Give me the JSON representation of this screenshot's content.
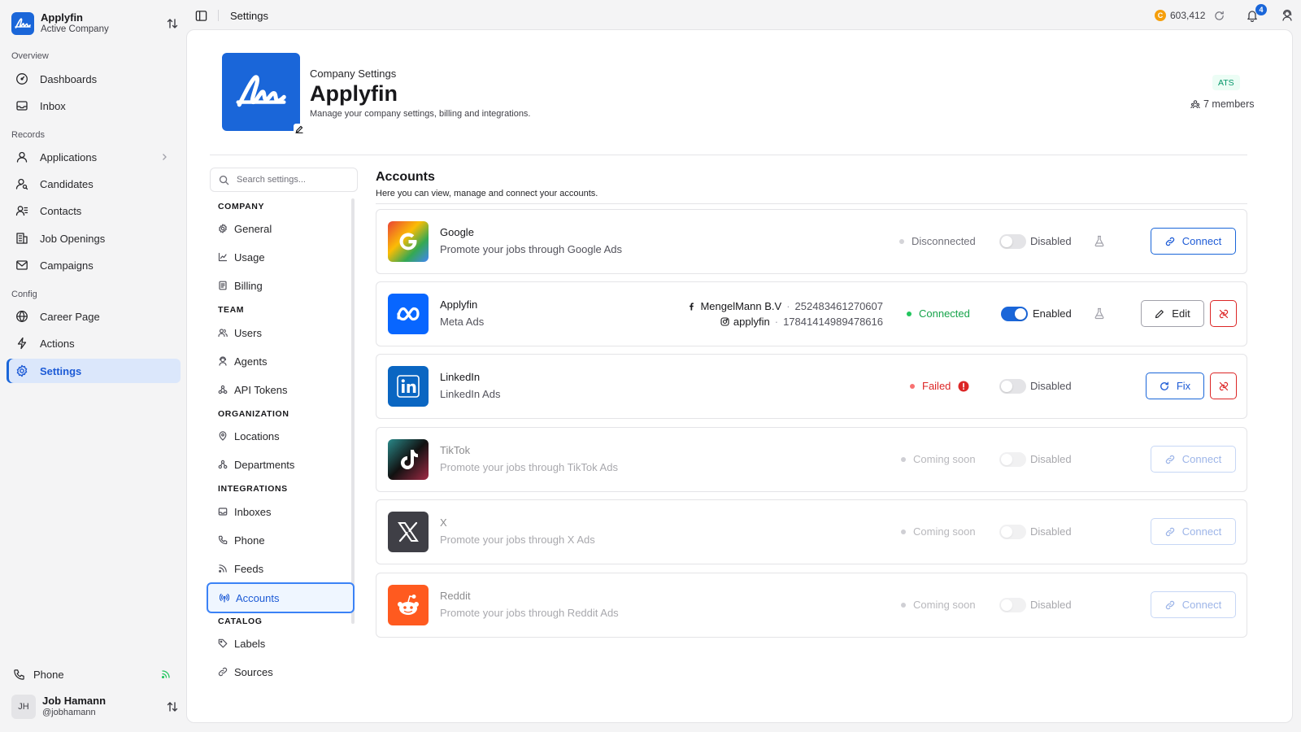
{
  "app": {
    "company_name": "Applyfin",
    "company_sub": "Active Company",
    "brand_color": "#1a66d9"
  },
  "sidebar": {
    "sections": [
      {
        "label": "Overview"
      },
      {
        "label": "Records"
      },
      {
        "label": "Config"
      }
    ],
    "items": [
      {
        "label": "Dashboards",
        "icon": "gauge-icon"
      },
      {
        "label": "Inbox",
        "icon": "inbox-icon"
      },
      {
        "label": "Applications",
        "icon": "user-icon"
      },
      {
        "label": "Candidates",
        "icon": "user-search-icon"
      },
      {
        "label": "Contacts",
        "icon": "contacts-icon"
      },
      {
        "label": "Job Openings",
        "icon": "building-icon"
      },
      {
        "label": "Campaigns",
        "icon": "mail-icon"
      },
      {
        "label": "Career Page",
        "icon": "globe-icon"
      },
      {
        "label": "Actions",
        "icon": "bolt-icon"
      },
      {
        "label": "Settings",
        "icon": "gear-icon",
        "active": true
      }
    ],
    "phone_label": "Phone",
    "user": {
      "initials": "JH",
      "name": "Job Hamann",
      "handle": "@jobhamann"
    }
  },
  "topbar": {
    "title": "Settings",
    "credits": "603,412",
    "coin_symbol": "C",
    "notifications": "4"
  },
  "company": {
    "kicker": "Company Settings",
    "title": "Applyfin",
    "description": "Manage your company settings, billing and integrations.",
    "badge": "ATS",
    "members": "7 members"
  },
  "settings_nav": {
    "search_placeholder": "Search settings...",
    "groups": [
      {
        "title": "COMPANY",
        "items": [
          "General",
          "Usage",
          "Billing"
        ]
      },
      {
        "title": "TEAM",
        "items": [
          "Users",
          "Agents",
          "API Tokens"
        ]
      },
      {
        "title": "ORGANIZATION",
        "items": [
          "Locations",
          "Departments"
        ]
      },
      {
        "title": "INTEGRATIONS",
        "items": [
          "Inboxes",
          "Phone",
          "Feeds",
          "Accounts"
        ]
      },
      {
        "title": "CATALOG",
        "items": [
          "Labels",
          "Sources"
        ]
      }
    ],
    "active": "Accounts"
  },
  "accounts": {
    "title": "Accounts",
    "description": "Here you can view, manage and connect your accounts.",
    "list": [
      {
        "name": "Google",
        "sub": "Promote your jobs through Google Ads",
        "status": "Disconnected",
        "status_color": "#d4d4d8",
        "toggle_label": "Disabled",
        "toggle_on": false,
        "action": "Connect"
      },
      {
        "name": "Applyfin",
        "sub": "Meta Ads",
        "status": "Connected",
        "status_color": "#22c55e",
        "toggle_label": "Enabled",
        "toggle_on": true,
        "action": "Edit",
        "meta": [
          {
            "icon": "facebook-icon",
            "name": "MengelMann B.V",
            "id": "252483461270607"
          },
          {
            "icon": "instagram-icon",
            "name": "applyfin",
            "id": "17841414989478616"
          }
        ]
      },
      {
        "name": "LinkedIn",
        "sub": "LinkedIn Ads",
        "status": "Failed",
        "status_color": "#ef4444",
        "toggle_label": "Disabled",
        "toggle_on": false,
        "action": "Fix"
      },
      {
        "name": "TikTok",
        "sub": "Promote your jobs through TikTok Ads",
        "status": "Coming soon",
        "status_color": "#d4d4d8",
        "toggle_label": "Disabled",
        "toggle_on": false,
        "action": "Connect"
      },
      {
        "name": "X",
        "sub": "Promote your jobs through X Ads",
        "status": "Coming soon",
        "status_color": "#d4d4d8",
        "toggle_label": "Disabled",
        "toggle_on": false,
        "action": "Connect"
      },
      {
        "name": "Reddit",
        "sub": "Promote your jobs through Reddit Ads",
        "status": "Coming soon",
        "status_color": "#d4d4d8",
        "toggle_label": "Disabled",
        "toggle_on": false,
        "action": "Connect"
      }
    ]
  }
}
